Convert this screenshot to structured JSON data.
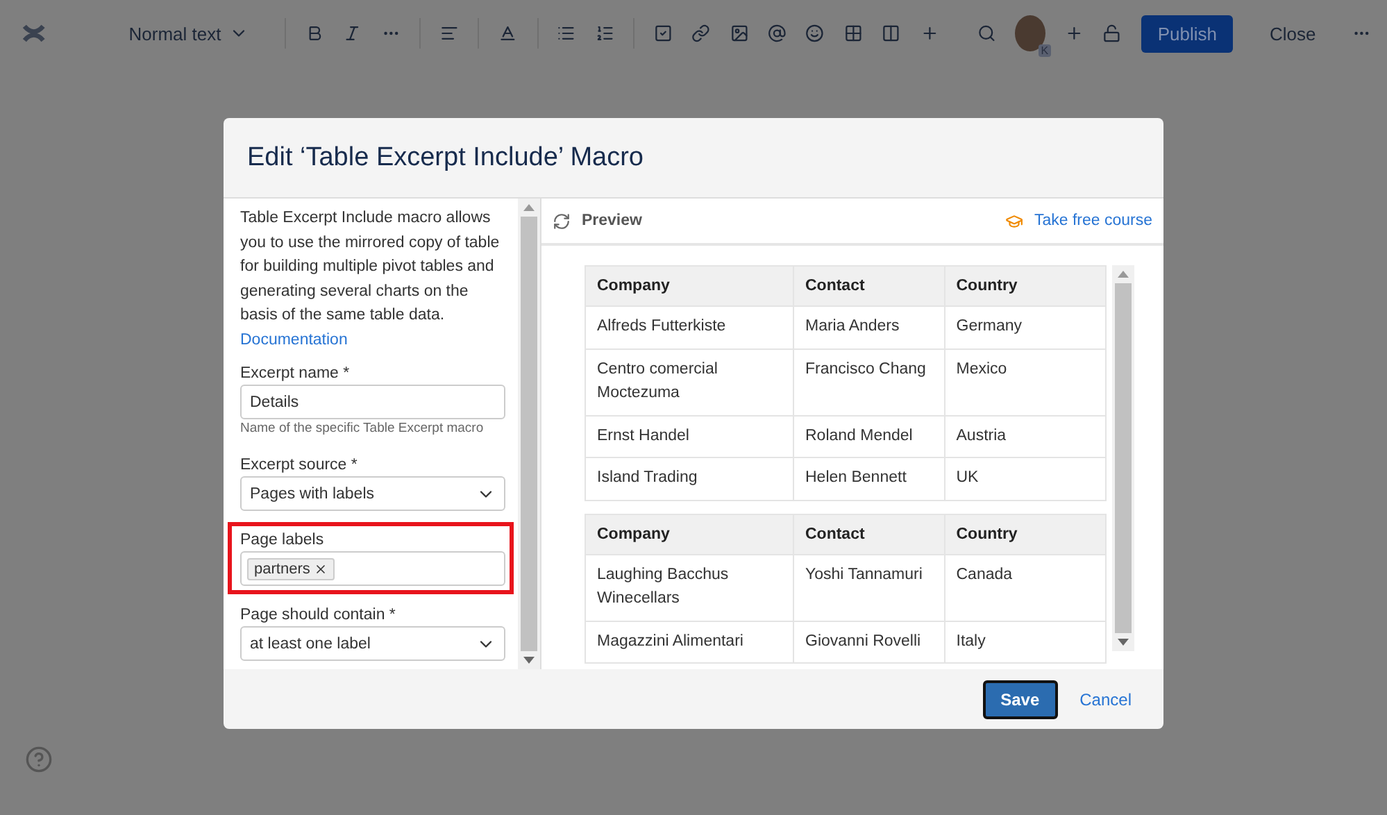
{
  "toolbar": {
    "text_style": "Normal text",
    "avatar_badge": "K",
    "publish": "Publish",
    "close": "Close"
  },
  "dialog": {
    "title": "Edit ‘Table Excerpt Include’ Macro",
    "description": "Table Excerpt Include macro allows you to use the mirrored copy of table for building multiple pivot tables and generating several charts on the basis of the same table data.",
    "doc_link": "Documentation",
    "fields": [
      {
        "kind": "text",
        "label": "Excerpt name *",
        "value": "Details",
        "hint": "Name of the specific Table Excerpt macro",
        "highlighted": false
      },
      {
        "kind": "select",
        "label": "Excerpt source *",
        "value": "Pages with labels",
        "highlighted": false
      },
      {
        "kind": "tags",
        "label": "Page labels",
        "tags": [
          "partners"
        ],
        "highlighted": true
      },
      {
        "kind": "select",
        "label": "Page should contain *",
        "value": "at least one label",
        "highlighted": false
      }
    ],
    "preview": {
      "title": "Preview",
      "course_link": "Take free course",
      "tables": [
        {
          "columns": [
            "Company",
            "Contact",
            "Country"
          ],
          "rows": [
            [
              "Alfreds Futterkiste",
              "Maria Anders",
              "Germany"
            ],
            [
              "Centro comercial Moctezuma",
              "Francisco Chang",
              "Mexico"
            ],
            [
              "Ernst Handel",
              "Roland Mendel",
              "Austria"
            ],
            [
              "Island Trading",
              "Helen Bennett",
              "UK"
            ]
          ]
        },
        {
          "columns": [
            "Company",
            "Contact",
            "Country"
          ],
          "rows": [
            [
              "Laughing Bacchus Winecellars",
              "Yoshi Tannamuri",
              "Canada"
            ],
            [
              "Magazzini Alimentari",
              "Giovanni Rovelli",
              "Italy"
            ]
          ]
        }
      ]
    },
    "save": "Save",
    "cancel": "Cancel"
  }
}
